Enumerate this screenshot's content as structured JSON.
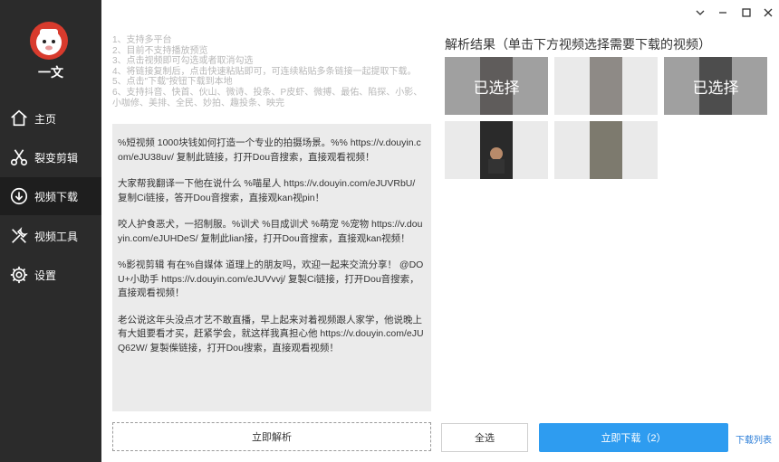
{
  "app": {
    "name": "一文"
  },
  "sidebar": {
    "items": [
      {
        "label": "主页",
        "icon": "home-icon"
      },
      {
        "label": "裂变剪辑",
        "icon": "scissors-icon"
      },
      {
        "label": "视频下载",
        "icon": "download-icon",
        "active": true
      },
      {
        "label": "视频工具",
        "icon": "tools-icon"
      },
      {
        "label": "设置",
        "icon": "gear-icon"
      }
    ]
  },
  "instructions": [
    "1、支持多平台",
    "2、目前不支持播放预览",
    "3、点击视频即可勾选或者取消勾选",
    "4、将链接复制后，点击快速粘贴即可，可连续粘贴多条链接一起提取下载。",
    "5、点击\"下载\"按钮下载到本地",
    "6、支持抖音、快首、伙山、微诗、投条、P皮虾、微搏、最佑、陷探、小影、小咖修、美排、全民、妙拍、趣投条、映完"
  ],
  "links": [
    "%短视频 1000块钱如何打造一个专业的拍摄场景。%% https://v.douyin.com/eJU38uv/ 复制此链接，打开Dou音搜索，直接观看视频！",
    "大家帮我翻译一下他在说什么 %喵星人  https://v.douyin.com/eJUVRbU/ 复制Ci链接，答开Dou音搜索，直接观kan视pin！",
    "咬人护食恶犬，一招制服。%训犬 %目成训犬 %萌宠 %宠物  https://v.douyin.com/eJUHDeS/ 复制此lian接，打开Dou音搜索，直接观kan视频！",
    "%影视剪辑  有在%自媒体 道理上的朋友吗，欢迎一起来交流分享！ @DOU+小助手  https://v.douyin.com/eJUVvvj/ 复製Ci链接，打开Dou音搜索，直接观看视频！",
    "老公说这年头没点才艺不敢直播，早上起来对着视频跟人家学，他说晚上有大姐要看才买，赶紧学会，就这样我真担心他  https://v.douyin.com/eJUQ62W/ 复製偨链接，打开Dou搜索，直接观看视频！"
  ],
  "parse_button": "立即解析",
  "results": {
    "title": "解析结果（单击下方视频选择需要下载的视频）",
    "selected_label": "已选择",
    "thumbs": [
      {
        "selected": true,
        "frame_color": "#4a4240"
      },
      {
        "selected": false,
        "frame_color": "#8e8a86"
      },
      {
        "selected": true,
        "frame_color": "#1c1c1c"
      },
      {
        "selected": false,
        "frame_color": "#2a2a2a"
      },
      {
        "selected": false,
        "frame_color": "#7d7a6e"
      }
    ]
  },
  "select_all_button": "全选",
  "download_button": "立即下载（2）",
  "download_list_link": "下载列表",
  "colors": {
    "sidebar_bg": "#2b2b2b",
    "accent": "#2e9cf0",
    "logo": "#d83b2d"
  }
}
